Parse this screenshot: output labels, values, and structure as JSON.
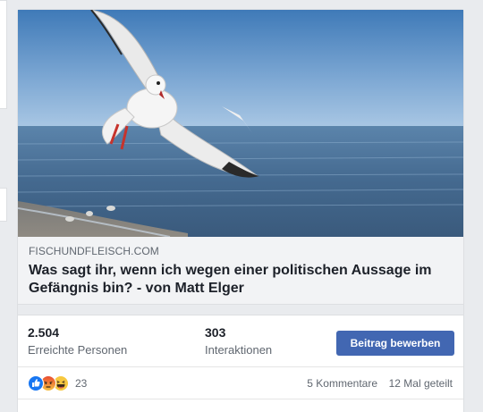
{
  "post": {
    "image_alt": "",
    "link": {
      "domain": "FISCHUNDFLEISCH.COM",
      "title": "Was sagt ihr, wenn ich wegen einer politischen Aussage im Gefängnis bin? - von Matt Elger"
    },
    "stats": {
      "reach": {
        "value": "2.504",
        "label": "Erreichte Personen"
      },
      "engagement": {
        "value": "303",
        "label": "Interaktionen"
      }
    },
    "boost_label": "Beitrag bewerben",
    "reactions": {
      "icons": [
        "like-icon",
        "angry-icon",
        "haha-icon"
      ],
      "count": "23",
      "comments": "5 Kommentare",
      "shares": "12 Mal geteilt"
    }
  },
  "colors": {
    "brand_blue": "#4267b2",
    "background": "#e9ebee",
    "link_box": "#f2f3f5"
  }
}
